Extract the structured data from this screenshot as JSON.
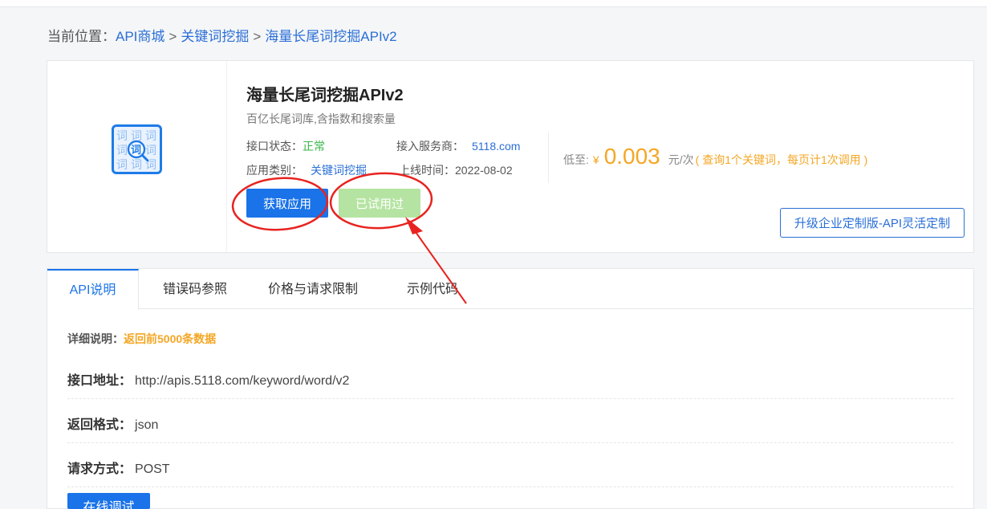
{
  "breadcrumb": {
    "prefix": "当前位置：",
    "items": [
      "API商城",
      "关键词挖掘",
      "海量长尾词挖掘APIv2"
    ],
    "separator": ">"
  },
  "product": {
    "logo_icon": "word-dictionary-icon",
    "title": "海量长尾词挖掘APIv2",
    "subtitle": "百亿长尾词库,含指数和搜索量",
    "status_label": "接口状态：",
    "status_value": "正常",
    "provider_label": "接入服务商：",
    "provider_value": "5118.com",
    "category_label": "应用类别：",
    "category_value": "关键词挖掘",
    "online_label": "上线时间：",
    "online_value": "2022-08-02"
  },
  "price": {
    "label": "低至:",
    "currency": "¥",
    "amount": "0.003",
    "unit": "元/次",
    "note": "( 查询1个关键词，每页计1次调用 )"
  },
  "buttons": {
    "get_app": "获取应用",
    "tried": "已试用过",
    "upgrade": "升级企业定制版-API灵活定制",
    "debug": "在线调试"
  },
  "tabs": [
    {
      "label": "API说明",
      "active": true
    },
    {
      "label": "错误码参照",
      "active": false
    },
    {
      "label": "价格与请求限制",
      "active": false
    },
    {
      "label": "示例代码",
      "active": false
    }
  ],
  "api_doc": {
    "detail_label": "详细说明：",
    "detail_value": "返回前5000条数据",
    "endpoint_label": "接口地址：",
    "endpoint_value": "http://apis.5118.com/keyword/word/v2",
    "format_label": "返回格式：",
    "format_value": "json",
    "method_label": "请求方式：",
    "method_value": "POST"
  },
  "colors": {
    "primary": "#1a73e8",
    "link": "#2a6fd6",
    "accent_orange": "#f5a623",
    "status_green": "#3ab54a",
    "disabled_green": "#b5e4a2",
    "annotation_red": "#e8231f"
  }
}
